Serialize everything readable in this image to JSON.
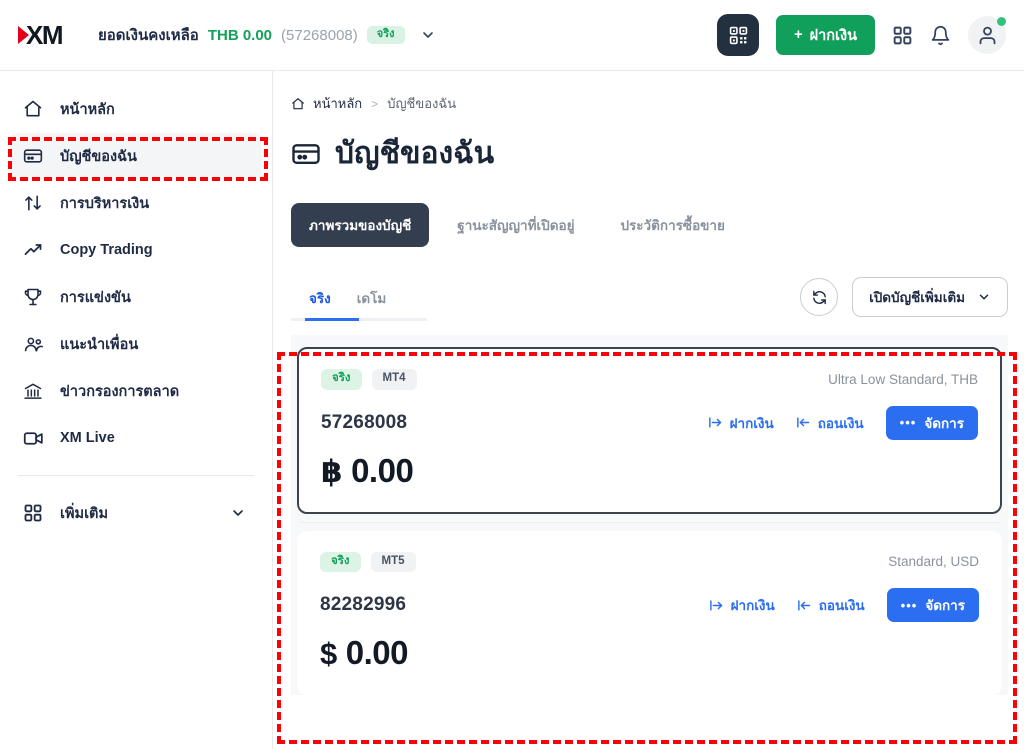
{
  "header": {
    "logo_text": "XM",
    "balance_label": "ยอดเงินคงเหลือ",
    "balance_amount": "THB 0.00",
    "balance_account": "(57268008)",
    "balance_badge": "จริง",
    "qr_icon": "qr-code-icon",
    "deposit_button": "+ ฝากเงิน",
    "deposit_plus": "+",
    "deposit_label": "ฝากเงิน",
    "grid_icon": "apps-grid-icon",
    "bell_icon": "notification-bell-icon",
    "avatar_icon": "user-avatar-icon",
    "chevron_icon": "chevron-down-icon"
  },
  "sidebar": {
    "items": [
      {
        "label": "หน้าหลัก",
        "icon": "home-icon",
        "active": false
      },
      {
        "label": "บัญชีของฉัน",
        "icon": "credit-card-icon",
        "active": true
      },
      {
        "label": "การบริหารเงิน",
        "icon": "transfer-arrows-icon",
        "active": false
      },
      {
        "label": "Copy Trading",
        "icon": "trend-up-icon",
        "active": false
      },
      {
        "label": "การแข่งขัน",
        "icon": "trophy-icon",
        "active": false
      },
      {
        "label": "แนะนำเพื่อน",
        "icon": "people-group-icon",
        "active": false
      },
      {
        "label": "ข่าวกรองการตลาด",
        "icon": "bank-institution-icon",
        "active": false
      },
      {
        "label": "XM Live",
        "icon": "video-camera-icon",
        "active": false
      }
    ],
    "more": {
      "label": "เพิ่มเติม",
      "icon": "apps-grid-icon",
      "chevron": "chevron-down-icon"
    }
  },
  "breadcrumb": {
    "home": "หน้าหลัก",
    "separator": ">",
    "current": "บัญชีของฉัน",
    "home_icon": "home-icon"
  },
  "page": {
    "title": "บัญชีของฉัน",
    "title_icon": "credit-card-icon"
  },
  "tabs": [
    {
      "label": "ภาพรวมของบัญชี",
      "active": true
    },
    {
      "label": "ฐานะสัญญาที่เปิดอยู่",
      "active": false
    },
    {
      "label": "ประวัติการซื้อขาย",
      "active": false
    }
  ],
  "subtabs": [
    {
      "label": "จริง",
      "active": true
    },
    {
      "label": "เดโม",
      "active": false
    }
  ],
  "toolbar": {
    "refresh_icon": "refresh-icon",
    "open_account_label": "เปิดบัญชีเพิ่มเติม",
    "open_account_chevron": "chevron-down-icon"
  },
  "accounts": [
    {
      "type_badge": "จริง",
      "platform_badge": "MT4",
      "account_type": "Ultra Low Standard, THB",
      "number": "57268008",
      "currency_symbol": "฿",
      "balance": "0.00",
      "deposit_label": "ฝากเงิน",
      "deposit_icon": "arrow-into-icon",
      "withdraw_label": "ถอนเงิน",
      "withdraw_icon": "arrow-out-icon",
      "manage_label": "จัดการ",
      "manage_dots": "•••",
      "selected": true
    },
    {
      "type_badge": "จริง",
      "platform_badge": "MT5",
      "account_type": "Standard, USD",
      "number": "82282996",
      "currency_symbol": "$",
      "balance": "0.00",
      "deposit_label": "ฝากเงิน",
      "deposit_icon": "arrow-into-icon",
      "withdraw_label": "ถอนเงิน",
      "withdraw_icon": "arrow-out-icon",
      "manage_label": "จัดการ",
      "manage_dots": "•••",
      "selected": false
    }
  ],
  "colors": {
    "brand_red": "#e2001a",
    "green": "#11a05b",
    "blue": "#2b6ef0",
    "dark": "#333f4f",
    "annotation_red": "#fb0007"
  }
}
